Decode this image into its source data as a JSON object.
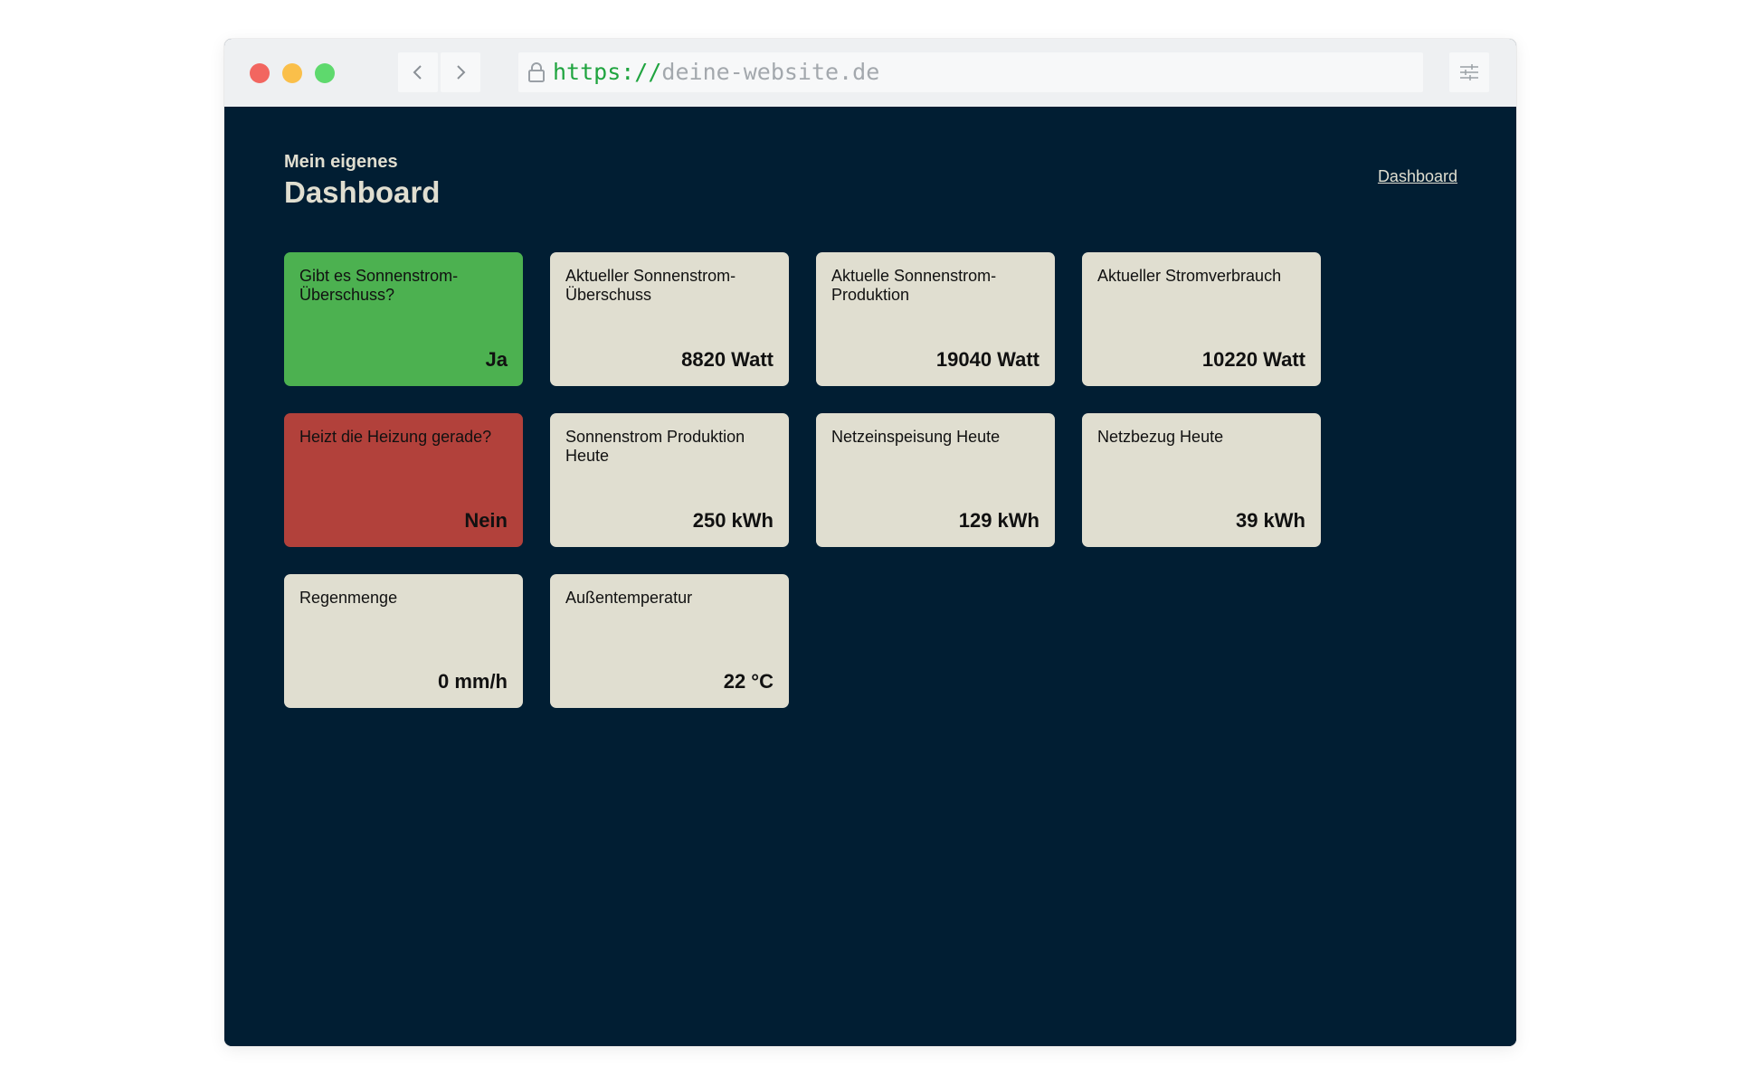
{
  "browser": {
    "url_scheme": "https://",
    "url_host": "deine-website.de",
    "traffic_lights": {
      "close": "#f26660",
      "minimize": "#fabf4a",
      "zoom": "#5ed96d"
    }
  },
  "header": {
    "subtitle": "Mein eigenes",
    "title": "Dashboard",
    "nav_link": "Dashboard"
  },
  "colors": {
    "page_background": "#011e33",
    "card_default": "#e0ded0",
    "card_positive": "#4cb150",
    "card_negative": "#b2413b"
  },
  "cards": [
    {
      "label": "Gibt es Sonnenstrom-Überschuss?",
      "value": "Ja",
      "status": "positive"
    },
    {
      "label": "Aktueller Sonnenstrom-Überschuss",
      "value": "8820 Watt",
      "status": "default"
    },
    {
      "label": "Aktuelle Sonnenstrom-Produktion",
      "value": "19040 Watt",
      "status": "default"
    },
    {
      "label": "Aktueller Stromverbrauch",
      "value": "10220 Watt",
      "status": "default"
    },
    {
      "label": "Heizt die Heizung gerade?",
      "value": "Nein",
      "status": "negative"
    },
    {
      "label": "Sonnenstrom Produktion Heute",
      "value": "250 kWh",
      "status": "default"
    },
    {
      "label": "Netzeinspeisung Heute",
      "value": "129 kWh",
      "status": "default"
    },
    {
      "label": "Netzbezug Heute",
      "value": "39 kWh",
      "status": "default"
    },
    {
      "label": "Regenmenge",
      "value": "0 mm/h",
      "status": "default"
    },
    {
      "label": "Außentemperatur",
      "value": "22 °C",
      "status": "default"
    }
  ]
}
